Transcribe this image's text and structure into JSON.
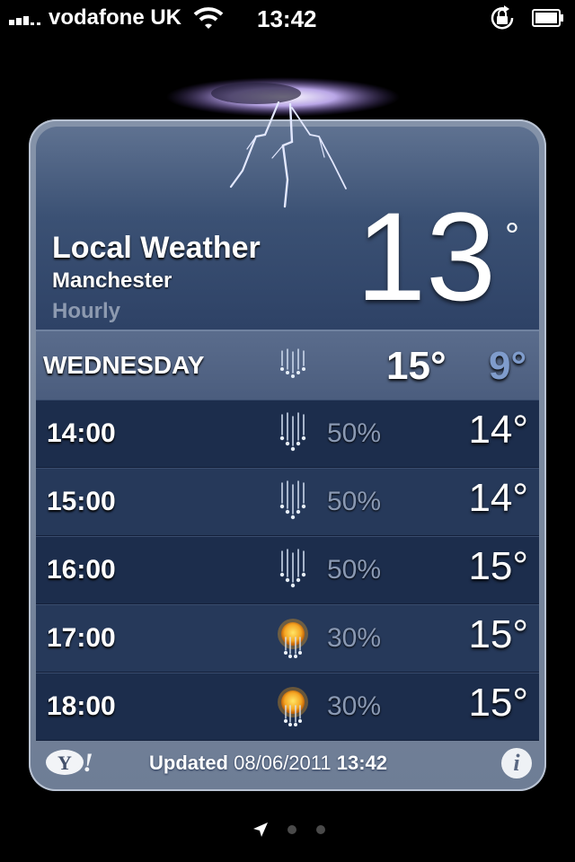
{
  "status_bar": {
    "carrier": "vodafone UK",
    "time": "13:42"
  },
  "weather": {
    "title": "Local Weather",
    "city": "Manchester",
    "mode": "Hourly",
    "current_temp": "13",
    "degree_symbol": "°",
    "condition_icon": "thunderstorm-icon"
  },
  "day": {
    "name": "WEDNESDAY",
    "icon": "rain-icon",
    "high": "15°",
    "low": "9°"
  },
  "hourly": [
    {
      "time": "14:00",
      "icon": "rain-icon",
      "pop": "50%",
      "temp": "14°"
    },
    {
      "time": "15:00",
      "icon": "rain-icon",
      "pop": "50%",
      "temp": "14°"
    },
    {
      "time": "16:00",
      "icon": "rain-icon",
      "pop": "50%",
      "temp": "15°"
    },
    {
      "time": "17:00",
      "icon": "sun-rain-icon",
      "pop": "30%",
      "temp": "15°"
    },
    {
      "time": "18:00",
      "icon": "sun-rain-icon",
      "pop": "30%",
      "temp": "15°"
    }
  ],
  "footer": {
    "updated_label": "Updated",
    "updated_date": "08/06/2011",
    "updated_time": "13:42",
    "info_label": "i"
  },
  "pager": {
    "page_count": 3,
    "current_page": 1
  },
  "colors": {
    "background": "#000000",
    "card_header": "#3b5174",
    "row_dark": "#1c2d4c",
    "row_light": "#26395a",
    "low_temp": "#7f9ccc"
  }
}
